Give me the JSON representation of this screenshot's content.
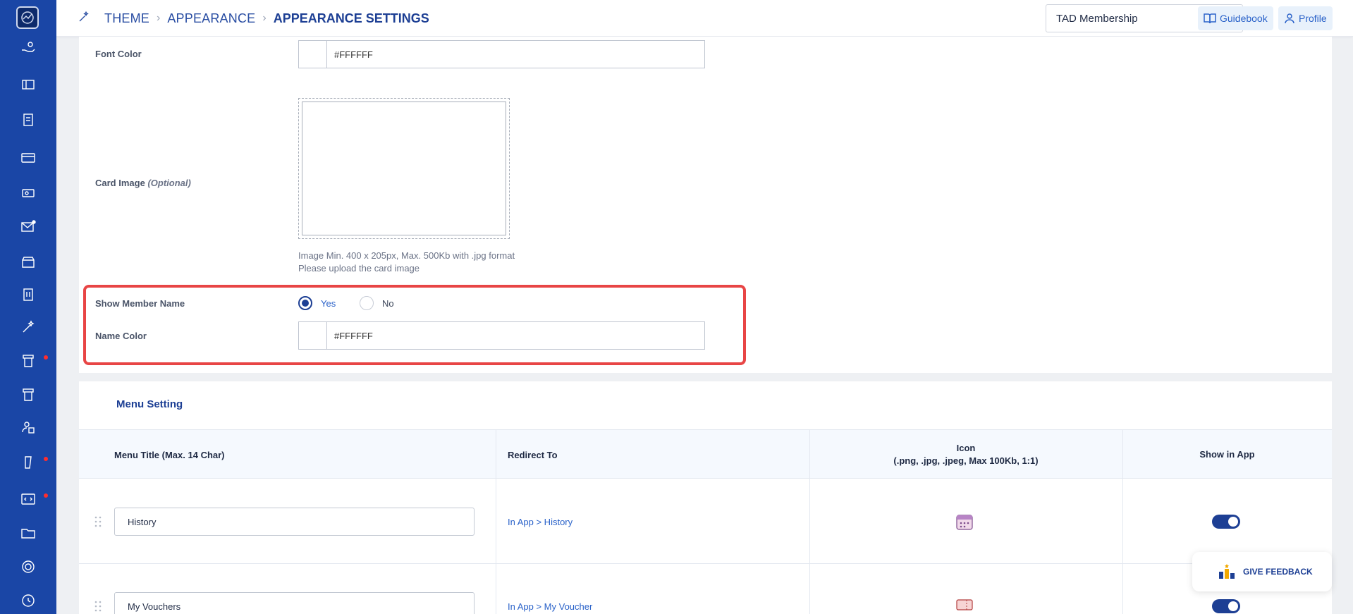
{
  "breadcrumb": {
    "items": [
      "THEME",
      "APPEARANCE"
    ],
    "current": "APPEARANCE SETTINGS"
  },
  "header": {
    "program_select": "TAD Membership",
    "guidebook_label": "Guidebook",
    "profile_label": "Profile"
  },
  "form": {
    "font_color_label": "Font Color",
    "font_color_value": "#FFFFFF",
    "card_image_label": "Card Image",
    "card_image_optional": "(Optional)",
    "image_hint_1": "Image Min. 400 x 205px, Max. 500Kb with .jpg format",
    "image_hint_2": "Please upload the card image",
    "show_member_name_label": "Show Member Name",
    "radio_yes": "Yes",
    "radio_no": "No",
    "name_color_label": "Name Color",
    "name_color_value": "#FFFFFF"
  },
  "menu": {
    "title": "Menu Setting",
    "headers": {
      "title": "Menu Title (Max. 14 Char)",
      "redirect": "Redirect To",
      "icon_line1": "Icon",
      "icon_line2": "(.png, .jpg, .jpeg, Max 100Kb, 1:1)",
      "show": "Show in App"
    },
    "rows": [
      {
        "title": "History",
        "redirect": "In App > History"
      },
      {
        "title": "My Vouchers",
        "redirect": "In App > My Voucher"
      }
    ]
  },
  "feedback_label": "GIVE FEEDBACK",
  "colors": {
    "sidebar": "#1a46a6",
    "accent": "#1d3f94",
    "link": "#2a62c9",
    "highlight": "#e84545"
  }
}
